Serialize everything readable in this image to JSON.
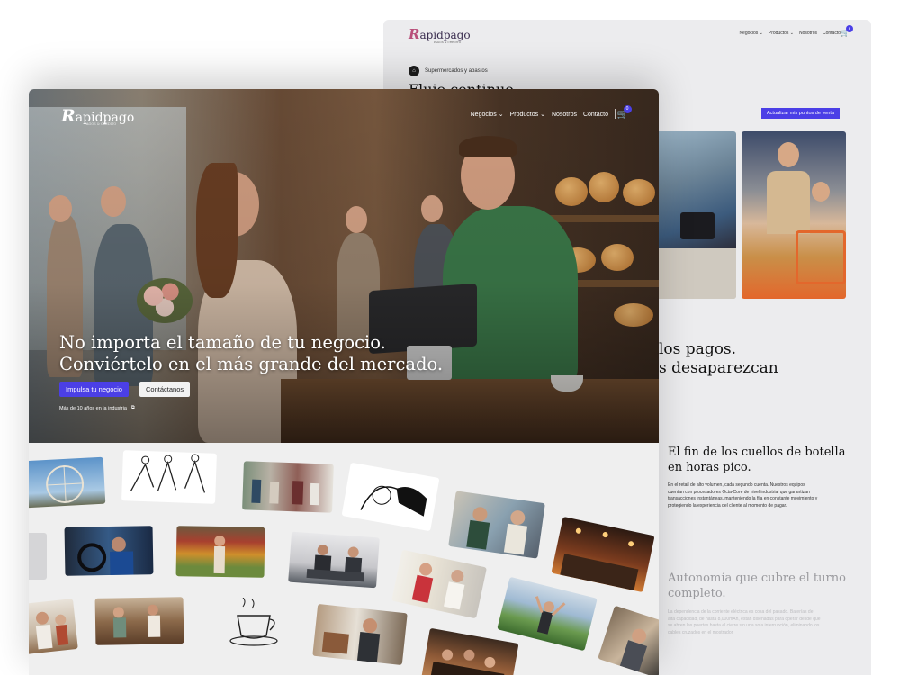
{
  "back_window": {
    "logo": {
      "letter": "R",
      "rest": "apidpago",
      "tagline": "PAGOS & CREDITO"
    },
    "nav": {
      "items": [
        "Negocios ⌄",
        "Productos ⌄",
        "Nosotros",
        "Contacto"
      ],
      "cart_count": "0"
    },
    "category": "Supermercados y abastos",
    "title": "Flujo continuo",
    "update_button": "Actualizar mis puntos de venta",
    "headline_lines": [
      "los pagos.",
      "s desaparezcan"
    ],
    "feature1": {
      "title_lines": [
        "El fin de los cuellos de botella",
        "en horas pico."
      ],
      "text": "En el retail de alto volumen, cada segundo cuenta. Nuestros equipos cuentan con procesadores Octa-Core de nivel industrial que garantizan transacciones instantáneas, manteniendo la fila en constante movimiento y protegiendo la experiencia del cliente al momento de pagar."
    },
    "feature2": {
      "title_lines": [
        "Autonomía que cubre el turno",
        "completo."
      ],
      "text": "La dependencia de la corriente eléctrica es cosa del pasado. Baterías de alta capacidad, de hasta 8,000mAh, están diseñadas para operar desde que se abren las puertas hasta el cierre sin una sola interrupción, eliminando los cables cruzados en el mostrador."
    }
  },
  "front_window": {
    "logo": {
      "letter": "R",
      "rest": "apidpago",
      "tagline": "PAGOS & CREDITO"
    },
    "nav": {
      "items": [
        "Negocios ⌄",
        "Productos ⌄",
        "Nosotros",
        "Contacto"
      ],
      "cart_count": "0"
    },
    "hero": {
      "headline_line1": "No importa el tamaño de tu negocio.",
      "headline_line2": "Conviértelo en el más grande del mercado.",
      "primary_cta": "Impulsa tu negocio",
      "secondary_cta": "Contáctanos",
      "experience": "Más de 10 años en la industria",
      "external_icon": "external-link-icon"
    },
    "collage_tiles": [
      "ferris-wheel-photo",
      "dancing-sketch",
      "clothing-store-photo",
      "woman-sketch",
      "cafe-payment-photo",
      "restaurant-night-photo",
      "mechanic-photo",
      "grocery-photo",
      "office-desk-photo",
      "market-vendor-photo",
      "outdoor-celebration-photo",
      "coffee-cup-sketch",
      "bakery-counter-photo",
      "barista-photo",
      "restaurant-crowd-photo",
      "family-photo",
      "shop-photo"
    ]
  },
  "colors": {
    "accent": "#4b3fe6",
    "back_bg": "#ececee",
    "front_bg": "#efefef"
  }
}
